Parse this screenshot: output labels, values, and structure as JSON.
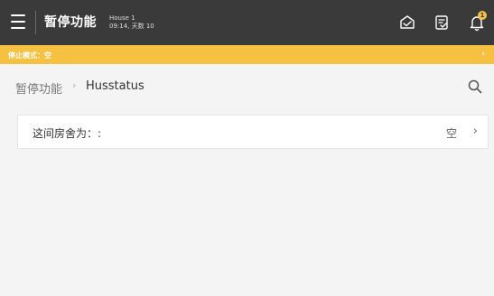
{
  "header": {
    "title": "暂停功能",
    "house_name": "House 1",
    "house_time": "09:14, 天数 10",
    "notification_count": "1"
  },
  "banner": {
    "text": "停止模式：空"
  },
  "breadcrumb": {
    "root": "暂停功能",
    "separator": "›",
    "current": "Husstatus"
  },
  "setting_row": {
    "label": "这间房舍为：:",
    "value": "空",
    "chevron": "›"
  },
  "colors": {
    "topbar": "#3a3a3a",
    "accent": "#f6c141",
    "background": "#f4f4f4"
  }
}
